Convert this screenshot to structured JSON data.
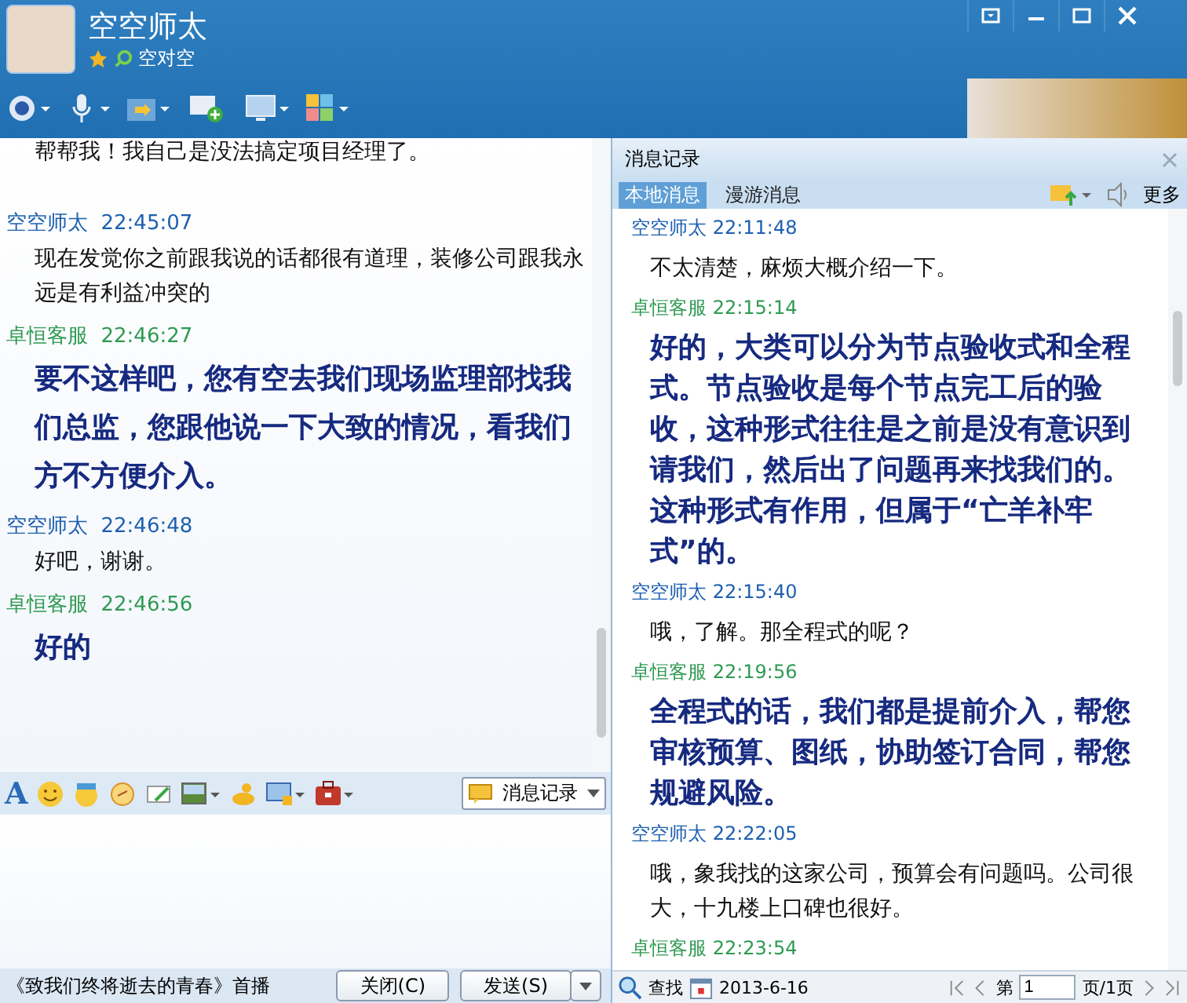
{
  "window": {
    "contact_name": "空空师太",
    "status_text": "空对空"
  },
  "chat": {
    "messages": [
      {
        "kind": "cut",
        "text": "帮帮我！我自己是没法搞定项目经理了。"
      },
      {
        "kind": "self",
        "sender": "空空师太",
        "time": "22:45:07",
        "text": "现在发觉你之前跟我说的话都很有道理，装修公司跟我永远是有利益冲突的"
      },
      {
        "kind": "service",
        "sender": "卓恒客服",
        "time": "22:46:27",
        "text": "要不这样吧，您有空去我们现场监理部找我们总监，您跟他说一下大致的情况，看我们方不方便介入。"
      },
      {
        "kind": "self",
        "sender": "空空师太",
        "time": "22:46:48",
        "text": "好吧，谢谢。"
      },
      {
        "kind": "service",
        "sender": "卓恒客服",
        "time": "22:46:56",
        "text": "好的"
      }
    ]
  },
  "input_toolbar": {
    "font_label": "A",
    "history_button": "消息记录"
  },
  "bottom_bar": {
    "ticker": "《致我们终将逝去的青春》首播",
    "close_button": "关闭(C)",
    "send_button": "发送(S)"
  },
  "history": {
    "title": "消息记录",
    "tabs": [
      {
        "label": "本地消息",
        "selected": true
      },
      {
        "label": "漫游消息",
        "selected": false
      }
    ],
    "more": "更多",
    "messages": [
      {
        "kind": "self",
        "sender": "空空师太",
        "time": "22:11:48",
        "text": "不太清楚，麻烦大概介绍一下。"
      },
      {
        "kind": "service",
        "sender": "卓恒客服",
        "time": "22:15:14",
        "text": "好的，大类可以分为节点验收式和全程式。节点验收是每个节点完工后的验收，这种形式往往是之前是没有意识到请我们，然后出了问题再来找我们的。这种形式有作用，但属于“亡羊补牢式”的。"
      },
      {
        "kind": "self",
        "sender": "空空师太",
        "time": "22:15:40",
        "text": "哦，了解。那全程式的呢？"
      },
      {
        "kind": "service",
        "sender": "卓恒客服",
        "time": "22:19:56",
        "text": "全程式的话，我们都是提前介入，帮您审核预算、图纸，协助签订合同，帮您规避风险。"
      },
      {
        "kind": "self",
        "sender": "空空师太",
        "time": "22:22:05",
        "text": "哦，象我找的这家公司，预算会有问题吗。公司很大，十九楼上口碑也很好。"
      },
      {
        "kind": "service",
        "sender": "卓恒客服",
        "time": "22:23:54"
      }
    ],
    "footer": {
      "search": "查找",
      "date": "2013-6-16",
      "page_prefix": "第",
      "page": "1",
      "page_suffix": "页/1页"
    }
  }
}
